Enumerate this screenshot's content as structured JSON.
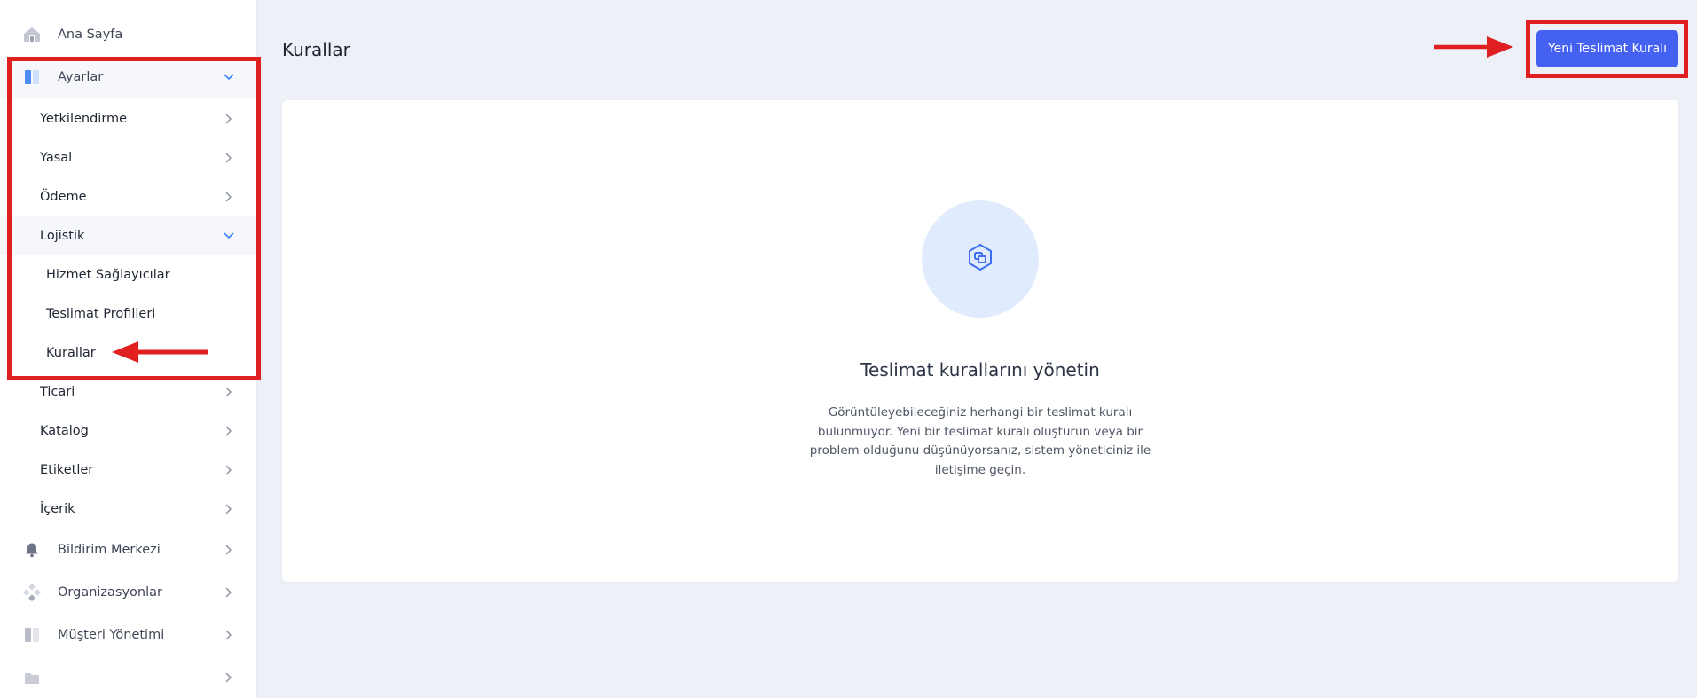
{
  "sidebar": {
    "home": "Ana Sayfa",
    "settings": "Ayarlar",
    "settings_children": {
      "authorization": "Yetkilendirme",
      "legal": "Yasal",
      "payment": "Ödeme",
      "logistics": "Lojistik",
      "logistics_children": {
        "providers": "Hizmet Sağlayıcılar",
        "delivery_profiles": "Teslimat Profilleri",
        "rules": "Kurallar"
      },
      "commercial": "Ticari",
      "catalog": "Katalog",
      "tags": "Etiketler",
      "content": "İçerik"
    },
    "notification_center": "Bildirim Merkezi",
    "organizations": "Organizasyonlar",
    "customer_management": "Müşteri Yönetimi",
    "last_item": ""
  },
  "header": {
    "title": "Kurallar",
    "new_rule_button": "Yeni Teslimat Kuralı"
  },
  "empty_state": {
    "title": "Teslimat kurallarını yönetin",
    "description": "Görüntüleyebileceğiniz herhangi bir teslimat kuralı bulunmuyor. Yeni bir teslimat kuralı oluşturun veya bir problem olduğunu düşünüyorsanız, sistem yöneticiniz ile iletişime geçin."
  },
  "colors": {
    "accent": "#4461f2",
    "annotation": "#e02020",
    "empty_icon_bg": "#e0ecfd",
    "page_bg": "#edf0f7"
  },
  "icons": {
    "home": "home-icon",
    "settings": "settings-panel-icon",
    "notification": "bell-icon",
    "organizations": "diamond-cluster-icon",
    "customers": "panel-icon",
    "empty_state": "hexagon-squares-icon"
  }
}
